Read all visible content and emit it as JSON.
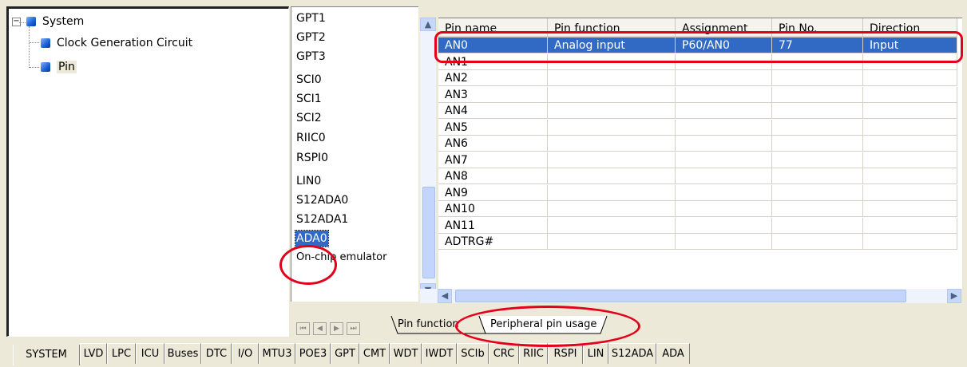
{
  "tree": {
    "items": [
      {
        "label": "System",
        "expander": "⊟"
      },
      {
        "label": "Clock Generation Circuit"
      },
      {
        "label": "Pin"
      }
    ]
  },
  "peripherals": {
    "items": [
      "GPT1",
      "GPT2",
      "GPT3",
      "SCI0",
      "SCI1",
      "SCI2",
      "RIIC0",
      "RSPI0",
      "LIN0",
      "S12ADA0",
      "S12ADA1",
      "ADA0",
      "On-chip emulator"
    ],
    "selected": "ADA0"
  },
  "grid": {
    "columns": [
      "Pin name",
      "Pin function",
      "Assignment",
      "Pin No.",
      "Direction"
    ],
    "rows": [
      [
        "AN0",
        "Analog input",
        "P60/AN0",
        "77",
        "Input"
      ],
      [
        "AN1",
        "",
        "",
        "",
        ""
      ],
      [
        "AN2",
        "",
        "",
        "",
        ""
      ],
      [
        "AN3",
        "",
        "",
        "",
        ""
      ],
      [
        "AN4",
        "",
        "",
        "",
        ""
      ],
      [
        "AN5",
        "",
        "",
        "",
        ""
      ],
      [
        "AN6",
        "",
        "",
        "",
        ""
      ],
      [
        "AN7",
        "",
        "",
        "",
        ""
      ],
      [
        "AN8",
        "",
        "",
        "",
        ""
      ],
      [
        "AN9",
        "",
        "",
        "",
        ""
      ],
      [
        "AN10",
        "",
        "",
        "",
        ""
      ],
      [
        "AN11",
        "",
        "",
        "",
        ""
      ],
      [
        "ADTRG#",
        "",
        "",
        "",
        ""
      ]
    ],
    "selected_row": 0
  },
  "sheet_tabs": [
    "Pin function",
    "Peripheral pin usage"
  ],
  "active_sheet_tab": "Peripheral pin usage",
  "bottom_tabs": [
    "SYSTEM",
    "LVD",
    "LPC",
    "ICU",
    "Buses",
    "DTC",
    "I/O",
    "MTU3",
    "POE3",
    "GPT",
    "CMT",
    "WDT",
    "IWDT",
    "SCIb",
    "CRC",
    "RIIC",
    "RSPI",
    "LIN",
    "S12ADA",
    "ADA"
  ],
  "active_bottom_tab": "SYSTEM",
  "colors": {
    "selection": "#316ac5",
    "annotation": "#e3001b",
    "icon": "#1a5fd6"
  }
}
